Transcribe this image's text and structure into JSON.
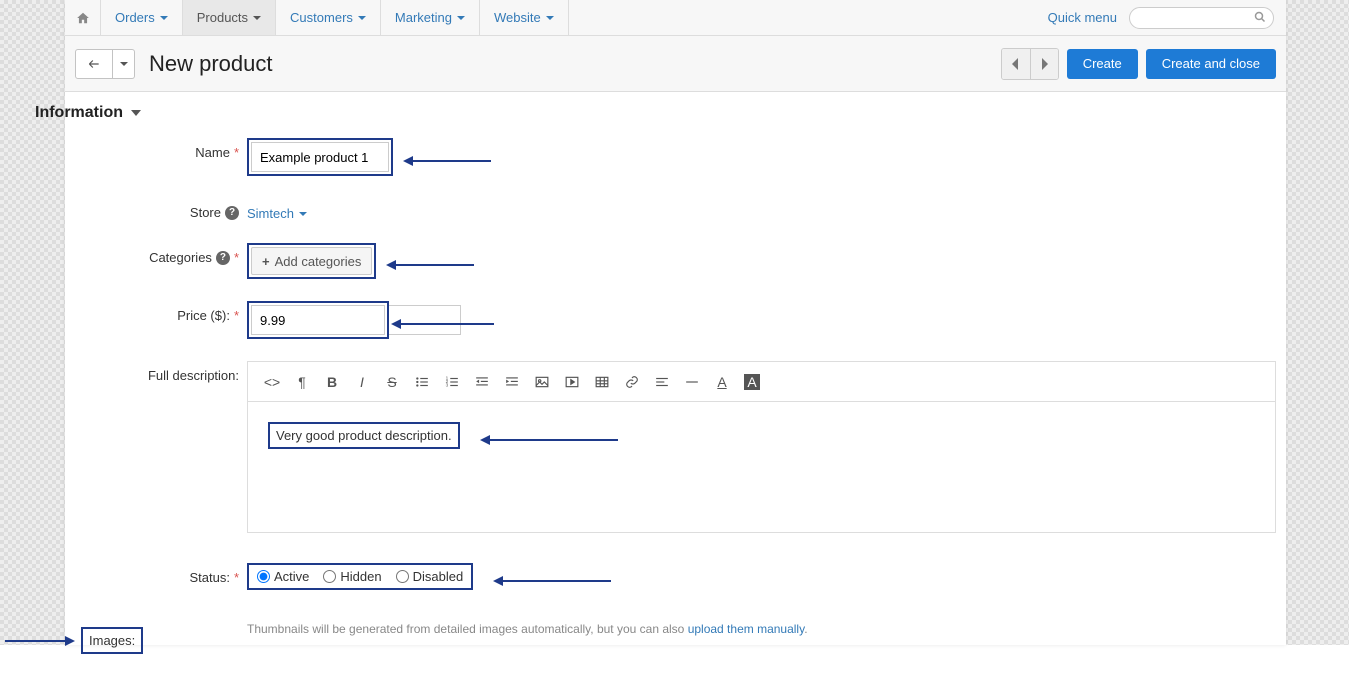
{
  "nav": {
    "home_icon": "home",
    "items": [
      {
        "label": "Orders",
        "active": false
      },
      {
        "label": "Products",
        "active": true
      },
      {
        "label": "Customers",
        "active": false
      },
      {
        "label": "Marketing",
        "active": false
      },
      {
        "label": "Website",
        "active": false
      }
    ],
    "quick_menu": "Quick menu",
    "search_placeholder": ""
  },
  "titlebar": {
    "page_title": "New product",
    "create": "Create",
    "create_close": "Create and close"
  },
  "section": {
    "information": "Information"
  },
  "form": {
    "name_label": "Name",
    "name_value": "Example product 1",
    "store_label": "Store",
    "store_value": "Simtech",
    "categories_label": "Categories",
    "add_categories": "Add categories",
    "price_label": "Price ($):",
    "price_value": "9.99",
    "full_desc_label": "Full description:",
    "full_desc_value": "Very good product description.",
    "status_label": "Status:",
    "status_options": {
      "active": "Active",
      "hidden": "Hidden",
      "disabled": "Disabled"
    },
    "images_label": "Images:",
    "images_hint_pre": "Thumbnails will be generated from detailed images automatically, but you can also ",
    "images_hint_link": "upload them manually",
    "images_hint_post": "."
  }
}
